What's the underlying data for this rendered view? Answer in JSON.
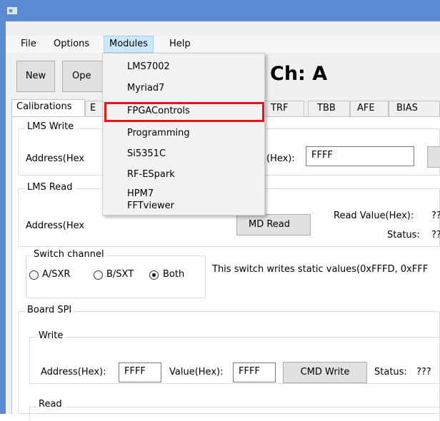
{
  "menubar": {
    "file": "File",
    "options": "Options",
    "modules": "Modules",
    "help": "Help"
  },
  "toolbar": {
    "new_label": "New",
    "open_label": "Ope",
    "channel_title": "Ch: A"
  },
  "tabs": [
    "Calibrations",
    "E",
    "TRF",
    "TBB",
    "AFE",
    "BIAS"
  ],
  "lms_write": {
    "legend": "LMS Write",
    "address_label": "Address(Hex",
    "value_label": "(Hex):",
    "value": "FFFF"
  },
  "lms_read": {
    "legend": "LMS Read",
    "address_label": "Address(Hex",
    "read_button": "MD Read",
    "read_value_label": "Read Value(Hex):",
    "read_value": "??",
    "status_label": "Status:",
    "status_value": "??"
  },
  "switch_channel": {
    "legend": "Switch channel",
    "options": [
      "A/SXR",
      "B/SXT",
      "Both"
    ],
    "selected": "Both",
    "note": "This switch writes static values(0xFFFD, 0xFFF"
  },
  "board_spi": {
    "legend": "Board SPI",
    "write": {
      "legend": "Write",
      "address_label": "Address(Hex):",
      "address": "FFFF",
      "value_label": "Value(Hex):",
      "value": "FFFF",
      "button": "CMD Write",
      "status_label": "Status:",
      "status_value": "???"
    },
    "read": {
      "legend": "Read"
    }
  },
  "modules_menu": {
    "items": [
      "LMS7002",
      "Myriad7",
      "FPGAControls",
      "Programming",
      "Si5351C",
      "RF-ESpark",
      "HPM7",
      "FFTviewer"
    ],
    "highlighted": "FPGAControls"
  },
  "colors": {
    "titlebar": "#5b8ad3",
    "menu_active": "#cce8ff",
    "highlight_border": "#e8141a"
  }
}
